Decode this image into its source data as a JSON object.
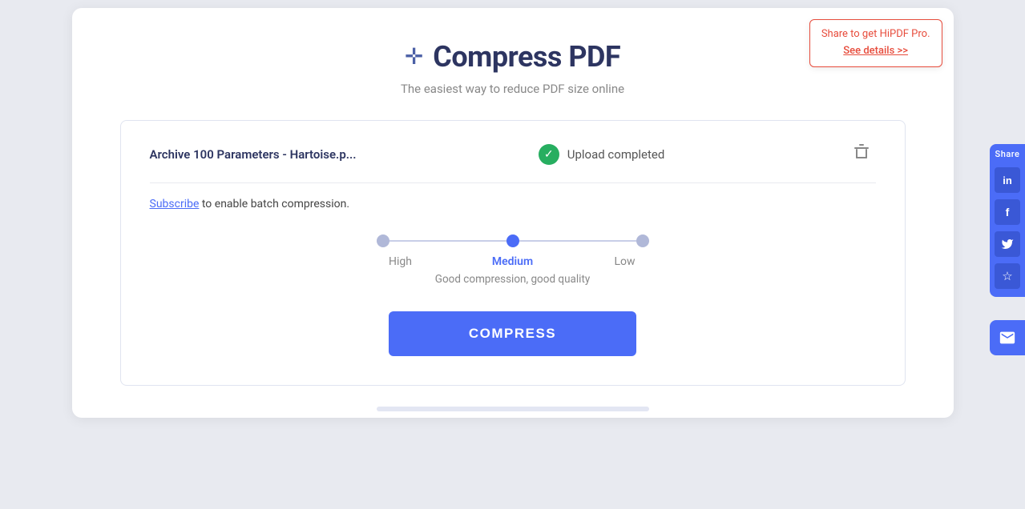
{
  "page": {
    "title": "Compress PDF",
    "subtitle": "The easiest way to reduce PDF size online",
    "icon": "✛"
  },
  "tooltip": {
    "line1": "Share to get HiPDF Pro.",
    "link": "See details >>"
  },
  "file": {
    "name": "Archive 100 Parameters - Hartoise.p...",
    "status": "Upload completed",
    "delete_label": "delete"
  },
  "subscribe": {
    "link_text": "Subscribe",
    "rest_text": " to enable batch compression."
  },
  "compression": {
    "levels": [
      {
        "label": "High",
        "active": false
      },
      {
        "label": "Medium",
        "active": true
      },
      {
        "label": "Low",
        "active": false
      }
    ],
    "description": "Good compression, good quality"
  },
  "compress_button": {
    "label": "COMPRESS"
  },
  "share": {
    "label": "Share",
    "icons": [
      "in",
      "f",
      "t",
      "☆"
    ]
  }
}
